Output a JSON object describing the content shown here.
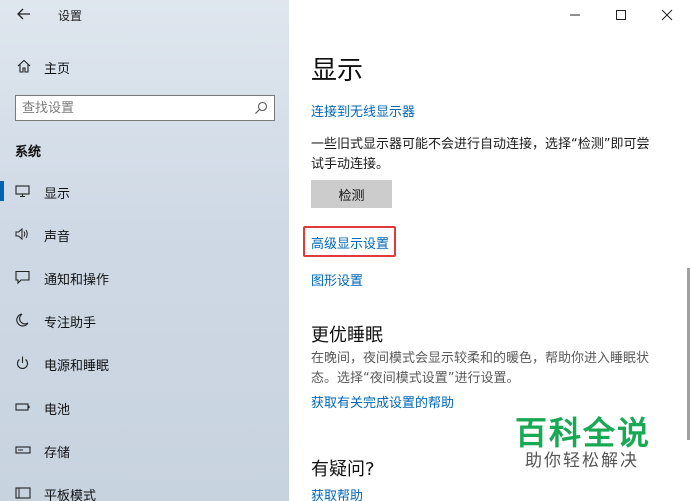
{
  "window": {
    "title": "设置",
    "controls": [
      "minimize-icon",
      "maximize-icon",
      "close-icon"
    ]
  },
  "sidebar": {
    "home_label": "主页",
    "search_placeholder": "查找设置",
    "section_heading": "系统",
    "items": [
      {
        "label": "显示",
        "icon": "monitor-icon",
        "selected": true
      },
      {
        "label": "声音",
        "icon": "speaker-icon",
        "selected": false
      },
      {
        "label": "通知和操作",
        "icon": "notification-icon",
        "selected": false
      },
      {
        "label": "专注助手",
        "icon": "moon-icon",
        "selected": false
      },
      {
        "label": "电源和睡眠",
        "icon": "power-icon",
        "selected": false
      },
      {
        "label": "电池",
        "icon": "battery-icon",
        "selected": false
      },
      {
        "label": "存储",
        "icon": "storage-icon",
        "selected": false
      },
      {
        "label": "平板模式",
        "icon": "tablet-icon",
        "selected": false
      }
    ]
  },
  "main": {
    "title": "显示",
    "connect_wireless_link": "连接到无线显示器",
    "legacy_text": "一些旧式显示器可能不会进行自动连接，选择“检测”即可尝试手动连接。",
    "detect_button": "检测",
    "advanced_link": "高级显示设置",
    "graphics_link": "图形设置",
    "sleep_title": "更优睡眠",
    "sleep_text": "在晚间，夜间模式会显示较柔和的暖色，帮助你进入睡眠状态。选择“夜间模式设置”进行设置。",
    "sleep_help_link": "获取有关完成设置的帮助",
    "question_title": "有疑问?",
    "get_help_link": "获取帮助"
  },
  "watermark": {
    "main": "百科全说",
    "sub": "助你轻松解决"
  },
  "colors": {
    "accent": "#0067b8",
    "selection_bar": "#0063b1",
    "highlight_box": "#e03a3a",
    "watermark": "#19a955"
  }
}
